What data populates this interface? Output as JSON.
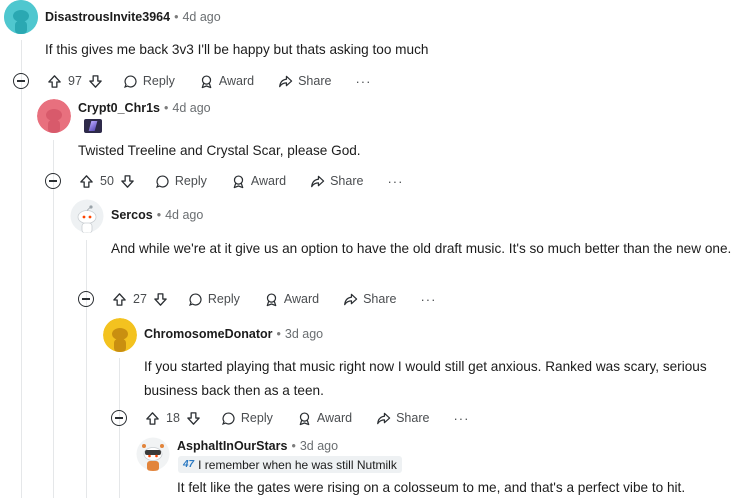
{
  "comments": [
    {
      "username": "DisastrousInvite3964",
      "time": "4d ago",
      "text": "If this gives me back 3v3 I'll be happy but thats asking too much",
      "votes": "97"
    },
    {
      "username": "Crypt0_Chr1s",
      "time": "4d ago",
      "text": "Twisted Treeline and Crystal Scar, please God.",
      "votes": "50"
    },
    {
      "username": "Sercos",
      "time": "4d ago",
      "text": "And while we're at it give us an option to have the old draft music. It's so much better than the new one.",
      "votes": "27"
    },
    {
      "username": "ChromosomeDonator",
      "time": "3d ago",
      "text": "If you started playing that music right now I would still get anxious. Ranked was scary, serious business back then as a teen.",
      "votes": "18"
    },
    {
      "username": "AsphaltInOurStars",
      "time": "3d ago",
      "flair_text": "I remember when he was still Nutmilk",
      "text": "It felt like the gates were rising on a colosseum to me, and that's a perfect vibe to hit."
    }
  ],
  "actions": {
    "reply": "Reply",
    "award": "Award",
    "share": "Share",
    "more": "···"
  },
  "colors": {
    "avatar_teal": "#4fc7cf",
    "avatar_pink": "#e8707e",
    "avatar_gold": "#f3c21f",
    "text": "#1c1c1c",
    "meta": "#6a6e71"
  }
}
